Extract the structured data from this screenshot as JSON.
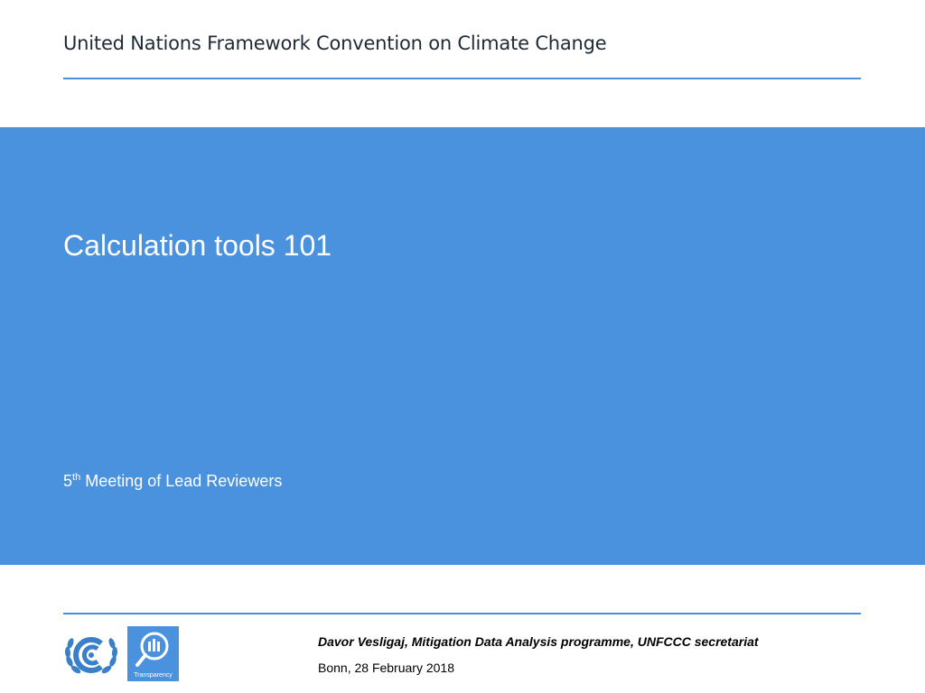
{
  "header": {
    "organization": "United Nations Framework Convention on Climate Change"
  },
  "title_band": {
    "title": "Calculation tools 101",
    "subtitle_ordinal_number": "5",
    "subtitle_ordinal_suffix": "th",
    "subtitle_rest": " Meeting of Lead Reviewers"
  },
  "footer": {
    "presenter": "Davor Vesligaj, Mitigation Data Analysis programme, UNFCCC secretariat",
    "venue_date": "Bonn, 28 February 2018",
    "logos": [
      {
        "icon": "unfccc-logo-icon"
      },
      {
        "icon": "transparency-logo-icon",
        "label": "Transparency"
      }
    ]
  },
  "colors": {
    "accent_blue": "#4a92de",
    "rule_blue": "#4a90d9",
    "header_text": "#1f2a36"
  }
}
